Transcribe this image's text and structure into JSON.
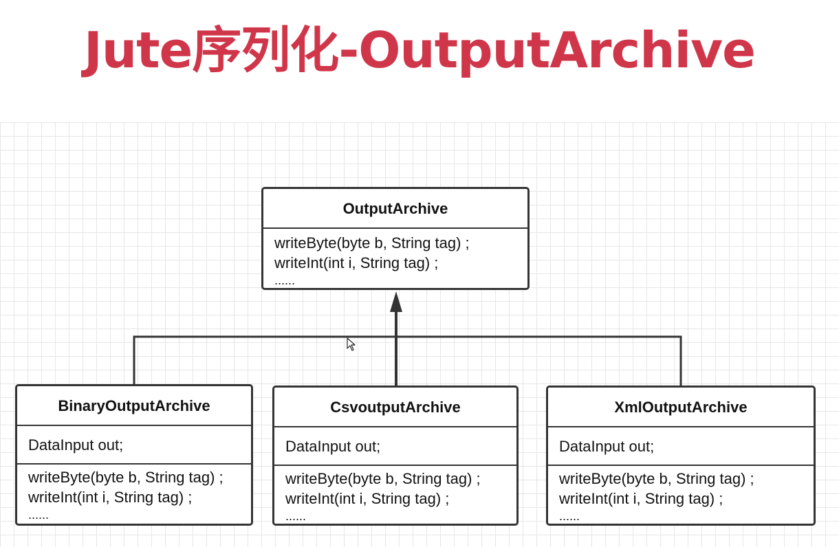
{
  "title": "Jute序列化-OutputArchive",
  "diagram": {
    "parent": {
      "name": "OutputArchive",
      "methods": [
        "writeByte(byte b, String tag) ;",
        "writeInt(int i, String tag) ;",
        "......"
      ]
    },
    "children": [
      {
        "name": "BinaryOutputArchive",
        "fields": [
          "DataInput out;"
        ],
        "methods": [
          "writeByte(byte b, String tag) ;",
          "writeInt(int i, String tag) ;",
          "......"
        ]
      },
      {
        "name": "CsvoutputArchive",
        "fields": [
          "DataInput out;"
        ],
        "methods": [
          "writeByte(byte b, String tag) ;",
          "writeInt(int i, String tag) ;",
          "......"
        ]
      },
      {
        "name": "XmlOutputArchive",
        "fields": [
          "DataInput out;"
        ],
        "methods": [
          "writeByte(byte b, String tag) ;",
          "writeInt(int i, String tag) ;",
          "......"
        ]
      }
    ],
    "colors": {
      "title": "#d0364a",
      "stroke": "#333333",
      "grid": "#e6e6e6"
    }
  }
}
